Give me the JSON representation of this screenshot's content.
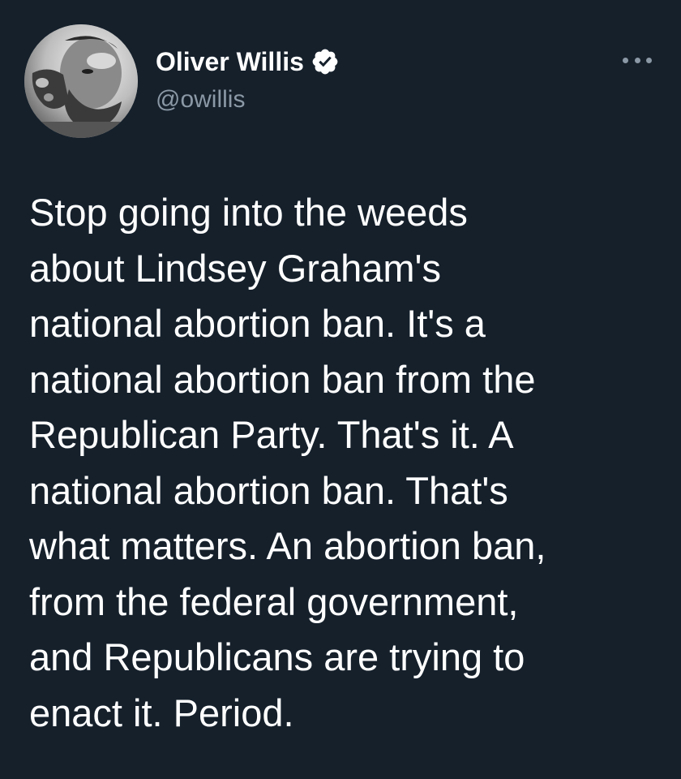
{
  "author": {
    "display_name": "Oliver Willis",
    "handle": "@owillis",
    "verified": true,
    "avatar_icon": "profile-photo"
  },
  "menu": {
    "icon": "more-options-icon"
  },
  "tweet": {
    "text": "Stop going into the weeds\nabout Lindsey Graham's\nnational abortion ban. It's a\nnational abortion ban from the\nRepublican Party. That's it. A\nnational abortion ban. That's\nwhat matters. An abortion ban,\nfrom the federal government,\nand Republicans are trying to\nenact it. Period."
  },
  "colors": {
    "background": "#15202b",
    "text": "#ffffff",
    "secondary_text": "#8b98a5",
    "verified_badge": "#ffffff"
  }
}
